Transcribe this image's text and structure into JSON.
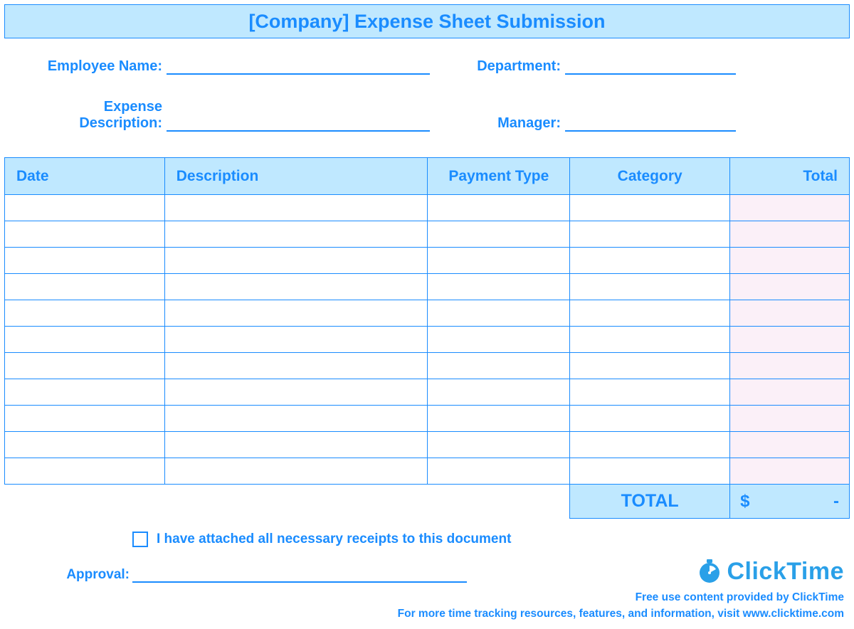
{
  "title": "[Company] Expense Sheet Submission",
  "info": {
    "employee_label": "Employee Name:",
    "employee_value": "",
    "department_label": "Department:",
    "department_value": "",
    "description_label": "Expense Description:",
    "description_value": "",
    "manager_label": "Manager:",
    "manager_value": ""
  },
  "columns": {
    "date": "Date",
    "description": "Description",
    "payment_type": "Payment Type",
    "category": "Category",
    "total": "Total"
  },
  "rows": [
    {
      "date": "",
      "description": "",
      "payment_type": "",
      "category": "",
      "total": ""
    },
    {
      "date": "",
      "description": "",
      "payment_type": "",
      "category": "",
      "total": ""
    },
    {
      "date": "",
      "description": "",
      "payment_type": "",
      "category": "",
      "total": ""
    },
    {
      "date": "",
      "description": "",
      "payment_type": "",
      "category": "",
      "total": ""
    },
    {
      "date": "",
      "description": "",
      "payment_type": "",
      "category": "",
      "total": ""
    },
    {
      "date": "",
      "description": "",
      "payment_type": "",
      "category": "",
      "total": ""
    },
    {
      "date": "",
      "description": "",
      "payment_type": "",
      "category": "",
      "total": ""
    },
    {
      "date": "",
      "description": "",
      "payment_type": "",
      "category": "",
      "total": ""
    },
    {
      "date": "",
      "description": "",
      "payment_type": "",
      "category": "",
      "total": ""
    },
    {
      "date": "",
      "description": "",
      "payment_type": "",
      "category": "",
      "total": ""
    },
    {
      "date": "",
      "description": "",
      "payment_type": "",
      "category": "",
      "total": ""
    }
  ],
  "grand_total": {
    "label": "TOTAL",
    "currency": "$",
    "amount": "-"
  },
  "receipts_checkbox": {
    "label": "I have attached all necessary receipts to this document",
    "checked": false
  },
  "approval": {
    "label": "Approval:",
    "value": ""
  },
  "footer": {
    "brand": "ClickTime",
    "line1": "Free use content provided by ClickTime",
    "line2": "For more time tracking resources, features, and information, visit www.clicktime.com"
  }
}
